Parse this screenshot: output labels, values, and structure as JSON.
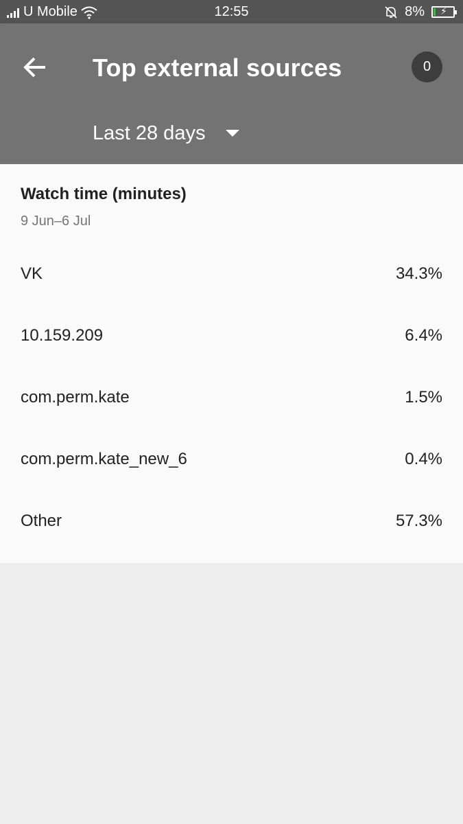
{
  "status_bar": {
    "carrier": "U Mobile",
    "time": "12:55",
    "battery": "8%",
    "icons": [
      "signal-icon",
      "wifi-icon",
      "mute-bell-icon",
      "battery-charging-icon"
    ]
  },
  "app_bar": {
    "back_icon": "arrow-left-icon",
    "title": "Top external sources",
    "badge_count": "0",
    "range_label": "Last 28 days",
    "range_icon": "dropdown-caret-icon"
  },
  "card": {
    "title": "Watch time (minutes)",
    "subtitle": "9 Jun–6 Jul",
    "rows": [
      {
        "label": "VK",
        "value": "34.3%"
      },
      {
        "label": "10.159.209",
        "value": "6.4%"
      },
      {
        "label": "com.perm.kate",
        "value": "1.5%"
      },
      {
        "label": "com.perm.kate_new_6",
        "value": "0.4%"
      },
      {
        "label": "Other",
        "value": "57.3%"
      }
    ]
  },
  "colors": {
    "app_bar": "#737373",
    "status_bar": "#545454",
    "card_bg": "#fafafa",
    "page_bg": "#eeeeee",
    "badge_bg": "#3d3d3d"
  }
}
